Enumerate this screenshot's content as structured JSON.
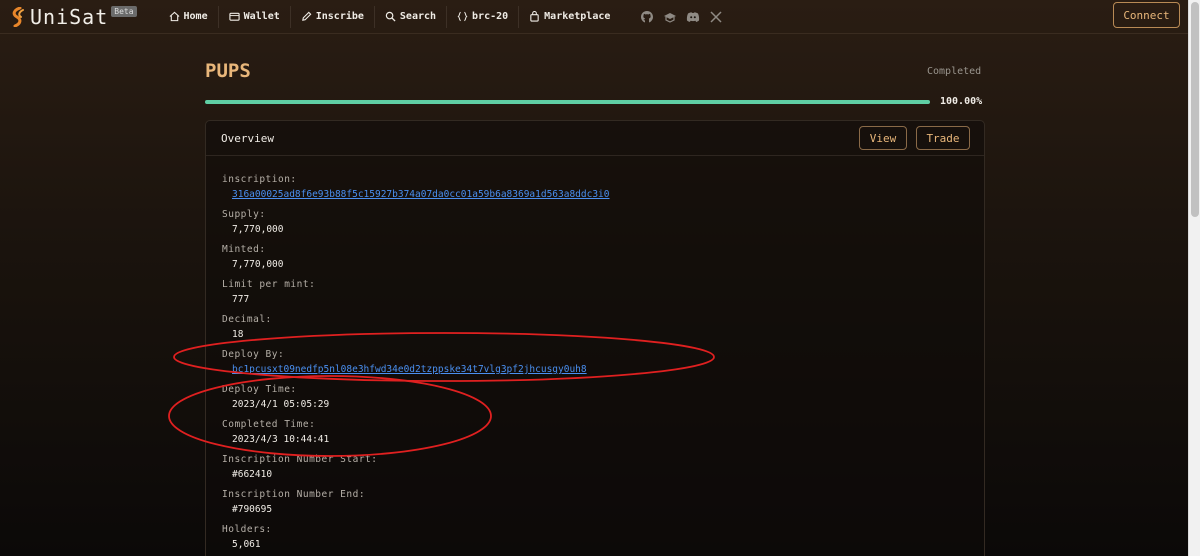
{
  "nav": {
    "brand": "UniSat",
    "beta": "Beta",
    "items": [
      {
        "label": "Home",
        "icon": "home-icon"
      },
      {
        "label": "Wallet",
        "icon": "wallet-icon"
      },
      {
        "label": "Inscribe",
        "icon": "pencil-icon"
      },
      {
        "label": "Search",
        "icon": "search-icon"
      },
      {
        "label": "brc-20",
        "icon": "braces-icon"
      },
      {
        "label": "Marketplace",
        "icon": "bag-icon"
      }
    ],
    "socials": [
      "github-icon",
      "gitbook-icon",
      "discord-icon",
      "x-icon"
    ],
    "connect": "Connect"
  },
  "token": {
    "name": "PUPS",
    "status": "Completed",
    "progress_percent": 100,
    "progress_label": "100.00%"
  },
  "card": {
    "title": "Overview",
    "view_label": "View",
    "trade_label": "Trade",
    "rows": [
      {
        "label": "inscription:",
        "value": "316a00025ad8f6e93b88f5c15927b374a07da0cc01a59b6a8369a1d563a8ddc3i0",
        "link": true
      },
      {
        "label": "Supply:",
        "value": "7,770,000",
        "link": false
      },
      {
        "label": "Minted:",
        "value": "7,770,000",
        "link": false
      },
      {
        "label": "Limit per mint:",
        "value": "777",
        "link": false
      },
      {
        "label": "Decimal:",
        "value": "18",
        "link": false
      },
      {
        "label": "Deploy By:",
        "value": "bc1pcusxt09nedfp5nl08e3hfwd34e0d2tzppske34t7vlg3pf2jhcusgy0uh8",
        "link": true
      },
      {
        "label": "Deploy Time:",
        "value": "2023/4/1 05:05:29",
        "link": false
      },
      {
        "label": "Completed Time:",
        "value": "2023/4/3 10:44:41",
        "link": false
      },
      {
        "label": "Inscription Number Start:",
        "value": "#662410",
        "link": false
      },
      {
        "label": "Inscription Number End:",
        "value": "#790695",
        "link": false
      },
      {
        "label": "Holders:",
        "value": "5,061",
        "link": false
      }
    ]
  },
  "colors": {
    "accent": "#e8b67a",
    "progress": "#5fcfa4",
    "link": "#4a8ff0",
    "annotation": "#e02020"
  }
}
